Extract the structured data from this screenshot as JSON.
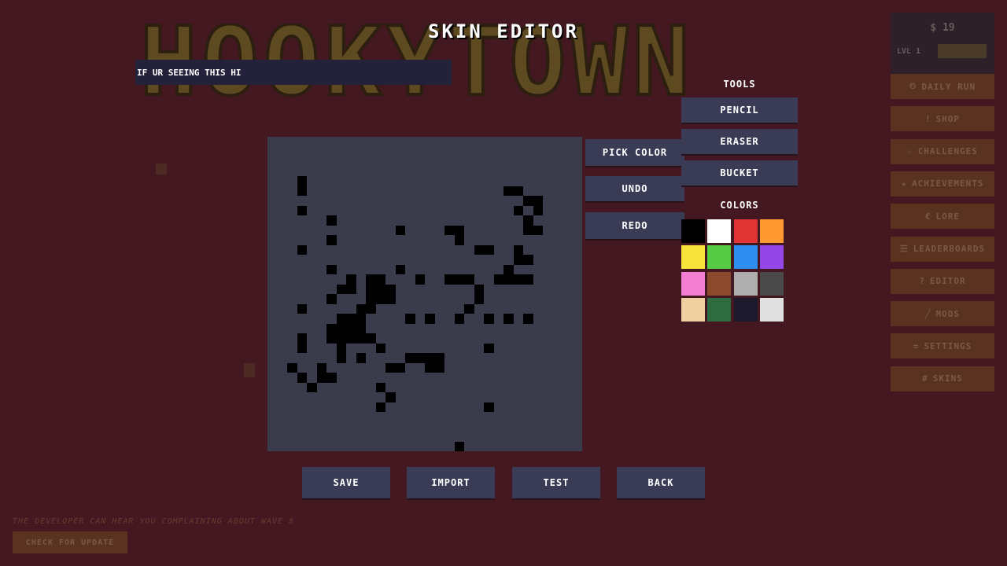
{
  "background_logo": "HOOKYTOWN",
  "title": "SKIN EDITOR",
  "message_input": {
    "value": "IF UR SEEING THIS HI"
  },
  "canvas": {
    "grid_size": 32,
    "filled_pixels": [
      [
        3,
        4
      ],
      [
        3,
        5
      ],
      [
        3,
        7
      ],
      [
        3,
        11
      ],
      [
        3,
        17
      ],
      [
        3,
        20
      ],
      [
        3,
        21
      ],
      [
        2,
        23
      ],
      [
        3,
        24
      ],
      [
        4,
        25
      ],
      [
        6,
        8
      ],
      [
        6,
        10
      ],
      [
        6,
        13
      ],
      [
        6,
        16
      ],
      [
        6,
        19
      ],
      [
        6,
        20
      ],
      [
        5,
        23
      ],
      [
        5,
        24
      ],
      [
        6,
        24
      ],
      [
        7,
        15
      ],
      [
        7,
        18
      ],
      [
        7,
        19
      ],
      [
        7,
        20
      ],
      [
        7,
        21
      ],
      [
        7,
        22
      ],
      [
        8,
        14
      ],
      [
        8,
        15
      ],
      [
        8,
        18
      ],
      [
        8,
        19
      ],
      [
        8,
        20
      ],
      [
        9,
        17
      ],
      [
        9,
        18
      ],
      [
        9,
        19
      ],
      [
        9,
        20
      ],
      [
        9,
        22
      ],
      [
        10,
        14
      ],
      [
        10,
        15
      ],
      [
        10,
        16
      ],
      [
        10,
        17
      ],
      [
        10,
        20
      ],
      [
        11,
        14
      ],
      [
        11,
        15
      ],
      [
        11,
        16
      ],
      [
        11,
        21
      ],
      [
        11,
        25
      ],
      [
        11,
        27
      ],
      [
        12,
        15
      ],
      [
        12,
        16
      ],
      [
        12,
        23
      ],
      [
        12,
        26
      ],
      [
        13,
        9
      ],
      [
        13,
        23
      ],
      [
        14,
        18
      ],
      [
        14,
        22
      ],
      [
        15,
        22
      ],
      [
        16,
        22
      ],
      [
        16,
        23
      ],
      [
        17,
        22
      ],
      [
        17,
        23
      ],
      [
        13,
        13
      ],
      [
        15,
        14
      ],
      [
        16,
        18
      ],
      [
        18,
        9
      ],
      [
        19,
        9
      ],
      [
        19,
        10
      ],
      [
        18,
        14
      ],
      [
        19,
        14
      ],
      [
        20,
        14
      ],
      [
        19,
        18
      ],
      [
        20,
        17
      ],
      [
        21,
        11
      ],
      [
        21,
        15
      ],
      [
        21,
        16
      ],
      [
        22,
        11
      ],
      [
        22,
        21
      ],
      [
        24,
        5
      ],
      [
        25,
        5
      ],
      [
        25,
        7
      ],
      [
        26,
        6
      ],
      [
        26,
        8
      ],
      [
        25,
        11
      ],
      [
        25,
        12
      ],
      [
        26,
        12
      ],
      [
        27,
        6
      ],
      [
        27,
        7
      ],
      [
        26,
        14
      ],
      [
        24,
        13
      ],
      [
        27,
        9
      ],
      [
        26,
        9
      ],
      [
        22,
        18
      ],
      [
        24,
        18
      ],
      [
        26,
        18
      ],
      [
        23,
        14
      ],
      [
        24,
        14
      ],
      [
        25,
        14
      ],
      [
        26,
        14
      ],
      [
        22,
        27
      ],
      [
        19,
        31
      ]
    ]
  },
  "tools": {
    "heading": "TOOLS",
    "pencil": "PENCIL",
    "eraser": "ERASER",
    "bucket": "BUCKET"
  },
  "actions": {
    "pick_color": "PICK COLOR",
    "undo": "UNDO",
    "redo": "REDO"
  },
  "colors": {
    "heading": "COLORS",
    "palette": [
      "#000000",
      "#ffffff",
      "#e03434",
      "#ff9a30",
      "#f8e33a",
      "#55cc44",
      "#2f8ff0",
      "#9447e6",
      "#f47fd2",
      "#8b4a2c",
      "#aeaeae",
      "#4a4a4a",
      "#f0cfa0",
      "#2e6b40",
      "#1c1a2c",
      "#e0e0e0"
    ]
  },
  "bottom_buttons": {
    "save": "SAVE",
    "import": "IMPORT",
    "test": "TEST",
    "back": "BACK"
  },
  "stats": {
    "money": "$ 19",
    "level": "LVL 1",
    "xp_progress": 0.0
  },
  "menu": [
    {
      "icon": "⏲",
      "label": "DAILY RUN"
    },
    {
      "icon": "!",
      "label": "SHOP"
    },
    {
      "icon": "☉",
      "label": "CHALLENGES"
    },
    {
      "icon": "★",
      "label": "ACHIEVEMENTS"
    },
    {
      "icon": "€",
      "label": "LORE"
    },
    {
      "icon": "☰",
      "label": "LEADERBOARDS"
    },
    {
      "icon": "?",
      "label": "EDITOR"
    },
    {
      "icon": "╱",
      "label": "MODS"
    },
    {
      "icon": "=",
      "label": "SETTINGS"
    },
    {
      "icon": "#",
      "label": "SKINS"
    }
  ],
  "developer_message": "THE DEVELOPER CAN HEAR YOU COMPLAINING ABOUT WAVE 8",
  "update_button": "CHECK FOR UPDATE"
}
